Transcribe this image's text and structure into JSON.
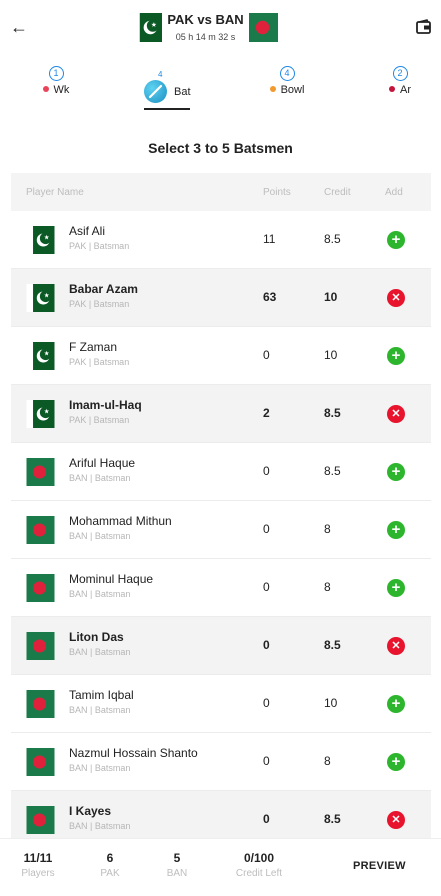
{
  "header": {
    "title": "PAK vs BAN",
    "timer": "05 h 14 m 32 s",
    "back_icon": "arrow-left-icon",
    "wallet_icon": "wallet-icon"
  },
  "tabs": [
    {
      "count": "1",
      "label": "Wk",
      "dot_color": "#e8455b"
    },
    {
      "count": "4",
      "label": "Bat",
      "active": true
    },
    {
      "count": "4",
      "label": "Bowl",
      "dot_color": "#f39a2e"
    },
    {
      "count": "2",
      "label": "Ar",
      "dot_color": "#c4163d"
    }
  ],
  "section_title": "Select 3 to 5 Batsmen",
  "table_headers": {
    "player": "Player Name",
    "points": "Points",
    "credit": "Credit",
    "add": "Add"
  },
  "players": [
    {
      "name": "Asif Ali",
      "meta": "PAK | Batsman",
      "team": "PAK",
      "points": "11",
      "credit": "8.5",
      "selected": false
    },
    {
      "name": "Babar Azam",
      "meta": "PAK | Batsman",
      "team": "PAK",
      "points": "63",
      "credit": "10",
      "selected": true
    },
    {
      "name": "F Zaman",
      "meta": "PAK | Batsman",
      "team": "PAK",
      "points": "0",
      "credit": "10",
      "selected": false
    },
    {
      "name": "Imam-ul-Haq",
      "meta": "PAK | Batsman",
      "team": "PAK",
      "points": "2",
      "credit": "8.5",
      "selected": true
    },
    {
      "name": "Ariful Haque",
      "meta": "BAN | Batsman",
      "team": "BAN",
      "points": "0",
      "credit": "8.5",
      "selected": false
    },
    {
      "name": "Mohammad Mithun",
      "meta": "BAN | Batsman",
      "team": "BAN",
      "points": "0",
      "credit": "8",
      "selected": false
    },
    {
      "name": "Mominul Haque",
      "meta": "BAN | Batsman",
      "team": "BAN",
      "points": "0",
      "credit": "8",
      "selected": false
    },
    {
      "name": "Liton Das",
      "meta": "BAN | Batsman",
      "team": "BAN",
      "points": "0",
      "credit": "8.5",
      "selected": true
    },
    {
      "name": "Tamim Iqbal",
      "meta": "BAN | Batsman",
      "team": "BAN",
      "points": "0",
      "credit": "10",
      "selected": false
    },
    {
      "name": "Nazmul Hossain Shanto",
      "meta": "BAN | Batsman",
      "team": "BAN",
      "points": "0",
      "credit": "8",
      "selected": false
    },
    {
      "name": "I Kayes",
      "meta": "BAN | Batsman",
      "team": "BAN",
      "points": "0",
      "credit": "8.5",
      "selected": true
    }
  ],
  "footer": {
    "players_value": "11/11",
    "players_label": "Players",
    "pak_value": "6",
    "pak_label": "PAK",
    "ban_value": "5",
    "ban_label": "BAN",
    "credit_value": "0/100",
    "credit_label": "Credit Left",
    "preview_label": "PREVIEW"
  },
  "colors": {
    "add": "#2db52d",
    "remove": "#e8132d",
    "accent": "#1e88e5",
    "pak_green": "#0b5a26",
    "ban_green": "#1b7a4a",
    "ban_red": "#e0213c"
  }
}
